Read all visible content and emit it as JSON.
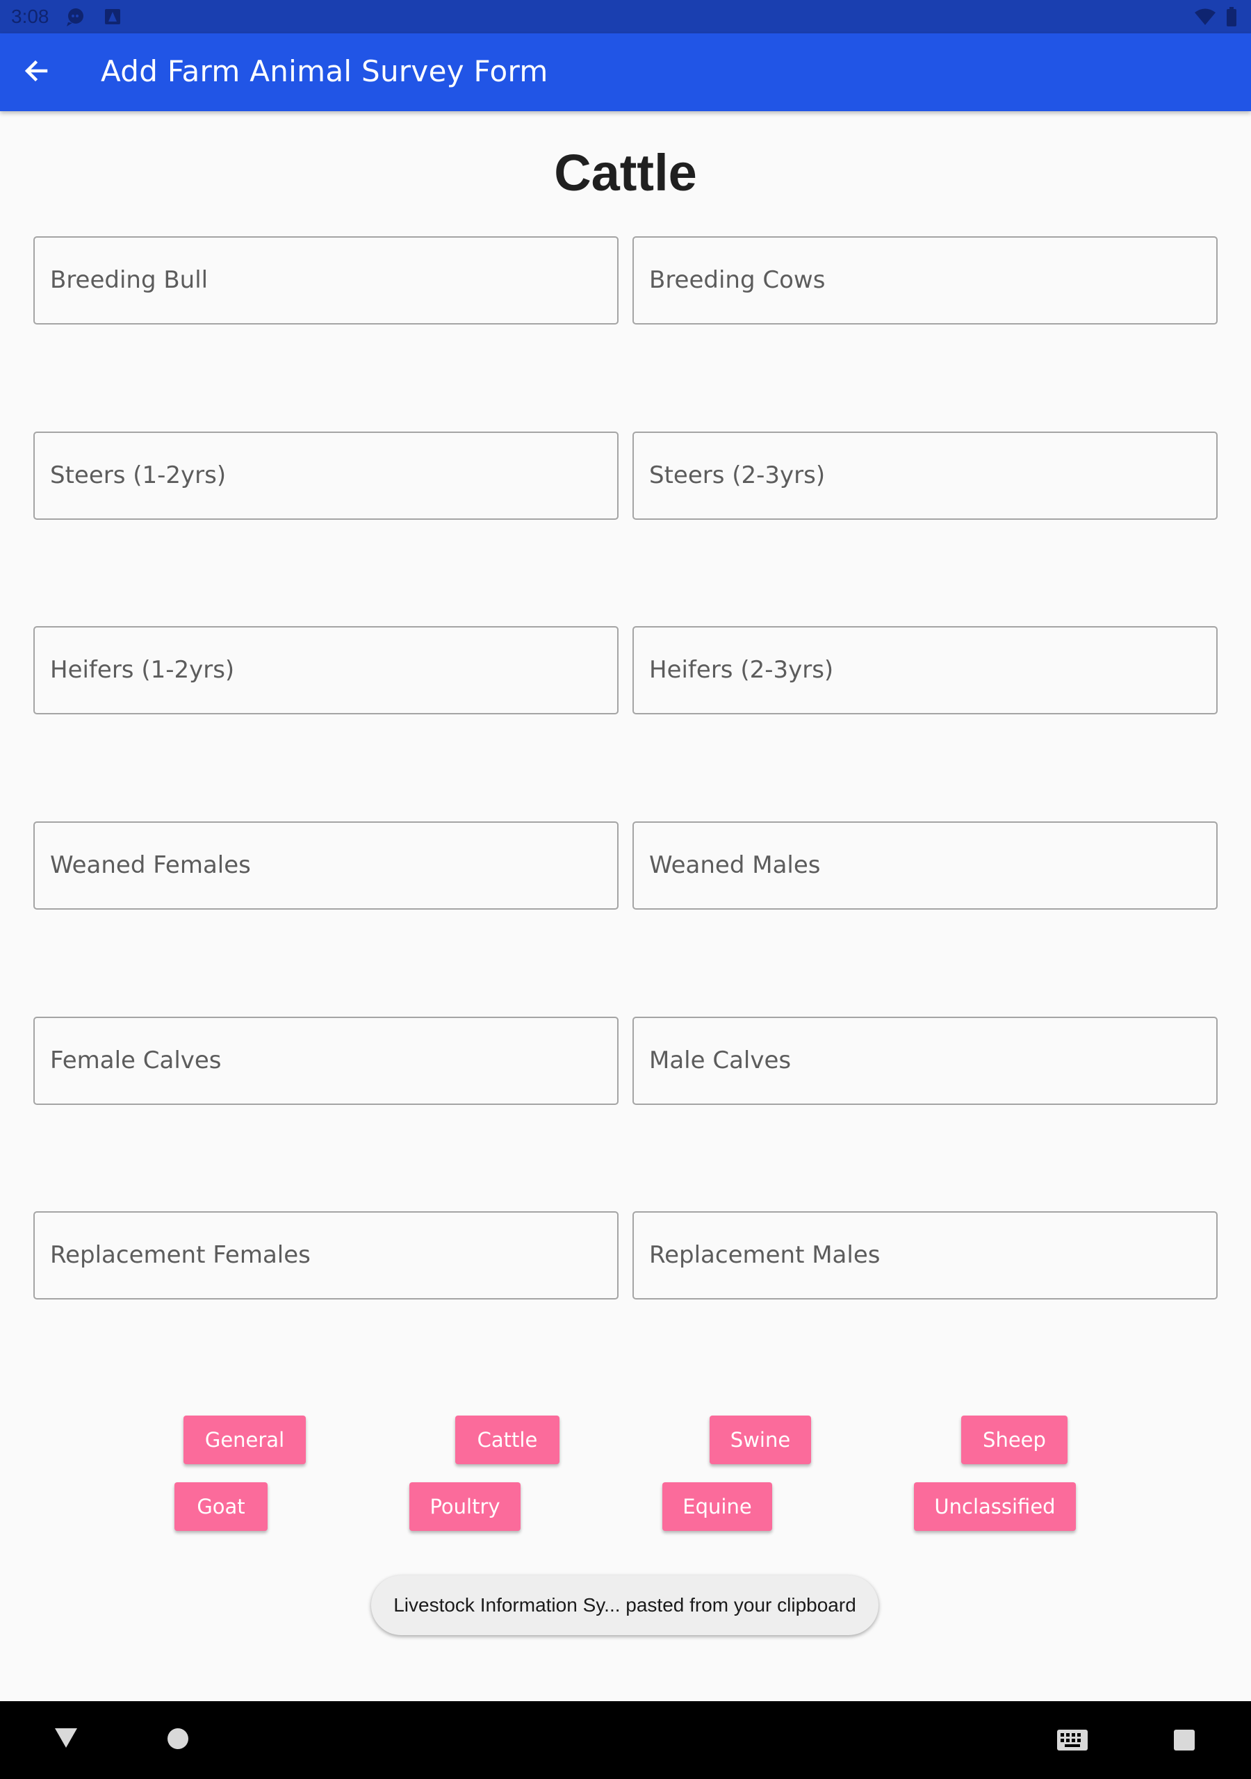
{
  "status_bar": {
    "time": "3:08",
    "icons_left": [
      "chat-notification-icon",
      "app-notification-icon"
    ],
    "icons_right": [
      "wifi-icon",
      "battery-icon"
    ]
  },
  "app_bar": {
    "back_icon": "arrow-left-icon",
    "title": "Add Farm Animal Survey Form"
  },
  "page": {
    "title": "Cattle"
  },
  "fields": [
    {
      "label": "Breeding Bull"
    },
    {
      "label": "Breeding Cows"
    },
    {
      "label": "Steers (1-2yrs)"
    },
    {
      "label": "Steers (2-3yrs)"
    },
    {
      "label": "Heifers (1-2yrs)"
    },
    {
      "label": "Heifers (2-3yrs)"
    },
    {
      "label": "Weaned Females"
    },
    {
      "label": "Weaned Males"
    },
    {
      "label": "Female Calves"
    },
    {
      "label": "Male Calves"
    },
    {
      "label": "Replacement Females"
    },
    {
      "label": "Replacement Males"
    }
  ],
  "categories": [
    {
      "label": "General"
    },
    {
      "label": "Cattle"
    },
    {
      "label": "Swine"
    },
    {
      "label": "Sheep"
    },
    {
      "label": "Goat"
    },
    {
      "label": "Poultry"
    },
    {
      "label": "Equine"
    },
    {
      "label": "Unclassified"
    }
  ],
  "toast": {
    "text": "Livestock Information Sy... pasted from your clipboard"
  },
  "nav_bar": {
    "icons": [
      "back-triangle-icon",
      "home-circle-icon",
      "keyboard-icon",
      "recents-square-icon"
    ]
  },
  "colors": {
    "status_bar": "#1a3fb0",
    "app_bar": "#2155e6",
    "chip": "#fb6b9b",
    "background": "#fafafa"
  }
}
